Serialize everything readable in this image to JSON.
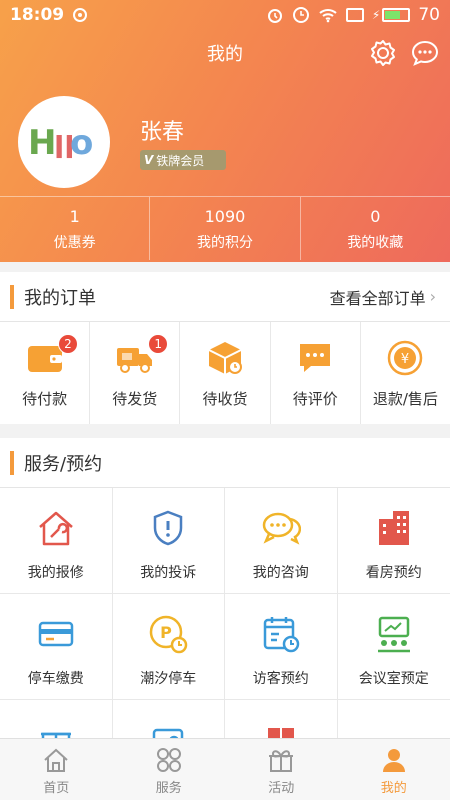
{
  "status_bar": {
    "time": "18:09",
    "battery": "70",
    "battery_level": 0.7
  },
  "header": {
    "title": "我的"
  },
  "profile": {
    "name": "张春",
    "member_level": "铁牌会员"
  },
  "stats": [
    {
      "value": "1",
      "label": "优惠券"
    },
    {
      "value": "1090",
      "label": "我的积分"
    },
    {
      "value": "0",
      "label": "我的收藏"
    }
  ],
  "orders": {
    "title": "我的订单",
    "view_all": "查看全部订单",
    "items": [
      {
        "label": "待付款",
        "badge": "2",
        "icon": "wallet-icon"
      },
      {
        "label": "待发货",
        "badge": "1",
        "icon": "truck-icon"
      },
      {
        "label": "待收货",
        "badge": "",
        "icon": "package-icon"
      },
      {
        "label": "待评价",
        "badge": "",
        "icon": "comment-icon"
      },
      {
        "label": "退款/售后",
        "badge": "",
        "icon": "refund-icon"
      }
    ]
  },
  "services": {
    "title": "服务/预约",
    "items": [
      {
        "label": "我的报修",
        "icon": "house-wrench-icon"
      },
      {
        "label": "我的投诉",
        "icon": "shield-alert-icon"
      },
      {
        "label": "我的咨询",
        "icon": "chat-bubbles-icon"
      },
      {
        "label": "看房预约",
        "icon": "building-icon"
      },
      {
        "label": "停车缴费",
        "icon": "card-icon"
      },
      {
        "label": "潮汐停车",
        "icon": "parking-clock-icon"
      },
      {
        "label": "访客预约",
        "icon": "calendar-clock-icon"
      },
      {
        "label": "会议室预定",
        "icon": "meeting-board-icon"
      }
    ]
  },
  "tabbar": [
    {
      "label": "首页",
      "icon": "home-icon",
      "active": false
    },
    {
      "label": "服务",
      "icon": "services-icon",
      "active": false
    },
    {
      "label": "活动",
      "icon": "gift-icon",
      "active": false
    },
    {
      "label": "我的",
      "icon": "user-icon",
      "active": true
    }
  ],
  "colors": {
    "accent": "#f49a3c",
    "badge": "#e94a3a",
    "gradient_start": "#f7a14a",
    "gradient_end": "#ee6a5c"
  }
}
